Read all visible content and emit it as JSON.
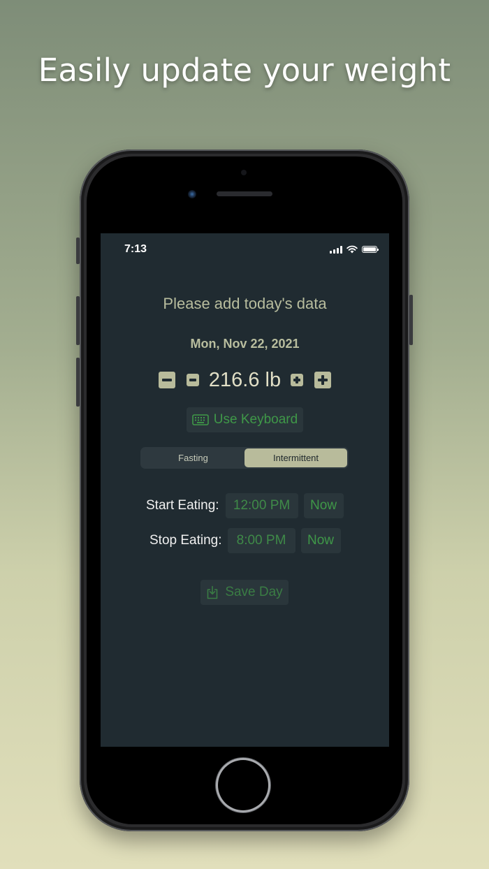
{
  "headline": "Easily update your weight",
  "status_bar": {
    "time": "7:13"
  },
  "screen": {
    "prompt": "Please add today's data",
    "date": "Mon, Nov 22, 2021",
    "weight": {
      "value": "216.6 lb"
    },
    "keyboard_button": {
      "label": "Use Keyboard",
      "icon": "keyboard-icon"
    },
    "segments": [
      {
        "label": "Fasting",
        "selected": false
      },
      {
        "label": "Intermittent",
        "selected": true
      }
    ],
    "start_eating": {
      "label": "Start Eating:",
      "time": "12:00 PM",
      "now": "Now"
    },
    "stop_eating": {
      "label": "Stop Eating:",
      "time": "8:00 PM",
      "now": "Now"
    },
    "save_button": {
      "label": "Save Day",
      "icon": "save-icon"
    }
  },
  "colors": {
    "accent_green": "#3f9848",
    "button_fill": "#b8bb9b",
    "screen_bg": "#202b31"
  }
}
